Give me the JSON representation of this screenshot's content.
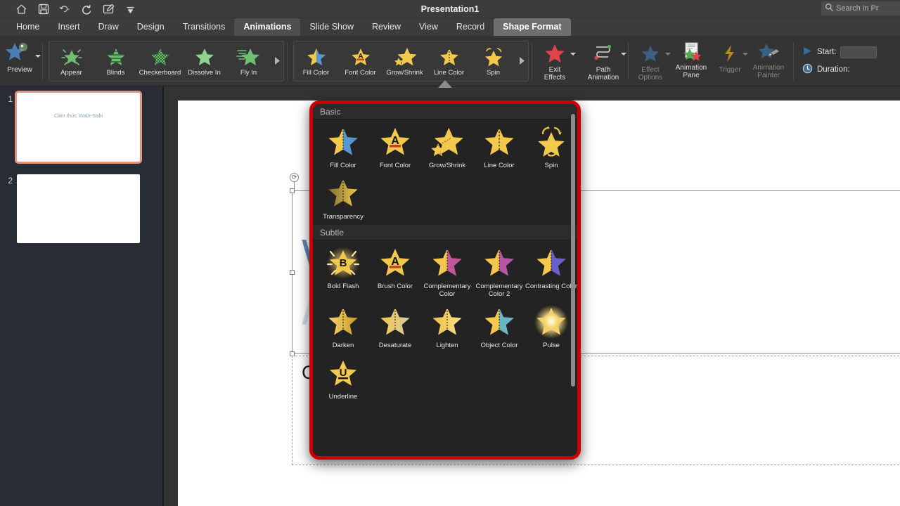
{
  "window": {
    "title": "Presentation1"
  },
  "quick_access": {
    "items": [
      {
        "name": "home-icon",
        "label": "Home"
      },
      {
        "name": "save-icon",
        "label": "Save"
      },
      {
        "name": "undo-icon",
        "label": "Undo"
      },
      {
        "name": "redo-icon",
        "label": "Redo"
      },
      {
        "name": "edit-mode-icon",
        "label": "Start Inking"
      },
      {
        "name": "customize-toolbar-icon",
        "label": "Customize"
      }
    ]
  },
  "search": {
    "placeholder": "Search in Pr",
    "icon": "search-icon"
  },
  "tabs": [
    {
      "label": "Home",
      "state": "normal"
    },
    {
      "label": "Insert",
      "state": "normal"
    },
    {
      "label": "Draw",
      "state": "normal"
    },
    {
      "label": "Design",
      "state": "normal"
    },
    {
      "label": "Transitions",
      "state": "normal"
    },
    {
      "label": "Animations",
      "state": "active"
    },
    {
      "label": "Slide Show",
      "state": "normal"
    },
    {
      "label": "Review",
      "state": "normal"
    },
    {
      "label": "View",
      "state": "normal"
    },
    {
      "label": "Record",
      "state": "normal"
    },
    {
      "label": "Shape Format",
      "state": "contextual"
    }
  ],
  "ribbon": {
    "preview": {
      "label": "Preview",
      "icon": "preview-star-icon"
    },
    "entrance_gallery": [
      {
        "label": "Appear",
        "icon": "star-appear-icon"
      },
      {
        "label": "Blinds",
        "icon": "star-blinds-icon"
      },
      {
        "label": "Checkerboard",
        "icon": "star-checkerboard-icon"
      },
      {
        "label": "Dissolve In",
        "icon": "star-dissolve-icon"
      },
      {
        "label": "Fly In",
        "icon": "star-flyin-icon"
      }
    ],
    "emphasis_gallery": [
      {
        "label": "Fill Color",
        "icon": "star-fill-color-icon"
      },
      {
        "label": "Font Color",
        "icon": "star-font-color-icon"
      },
      {
        "label": "Grow/Shrink",
        "icon": "star-grow-shrink-icon"
      },
      {
        "label": "Line Color",
        "icon": "star-line-color-icon"
      },
      {
        "label": "Spin",
        "icon": "star-spin-icon"
      }
    ],
    "buttons": [
      {
        "label": "Exit\nEffects",
        "line1": "Exit",
        "line2": "Effects",
        "icon": "red-star-icon",
        "enabled": true,
        "has_dropdown": true
      },
      {
        "label": "Path\nAnimation",
        "line1": "Path",
        "line2": "Animation",
        "icon": "motion-path-icon",
        "enabled": true,
        "has_dropdown": true
      },
      {
        "label": "Effect\nOptions",
        "line1": "Effect",
        "line2": "Options",
        "icon": "blue-star-icon",
        "enabled": false,
        "has_dropdown": true
      },
      {
        "label": "Animation\nPane",
        "line1": "Animation",
        "line2": "Pane",
        "icon": "animation-pane-icon",
        "enabled": true,
        "has_dropdown": false
      },
      {
        "label": "Trigger",
        "line1": "Trigger",
        "line2": "",
        "icon": "lightning-icon",
        "enabled": false,
        "has_dropdown": true
      },
      {
        "label": "Animation\nPainter",
        "line1": "Animation",
        "line2": "Painter",
        "icon": "animation-painter-icon",
        "enabled": false,
        "has_dropdown": false
      }
    ],
    "timing": {
      "start_label": "Start:",
      "start_value": "",
      "start_icon": "play-icon",
      "duration_label": "Duration:",
      "duration_value": "",
      "duration_icon": "clock-icon"
    },
    "more_arrow_icon": "chevron-right-icon",
    "expand_arrow_icon": "chevron-down-icon"
  },
  "thumbnails": [
    {
      "number": "1",
      "text": "Cảm thức Wabi-Sabi",
      "selected": true
    },
    {
      "number": "2",
      "text": "",
      "selected": false
    }
  ],
  "slide": {
    "title": "Wabi-Sabi",
    "subtitle_placeholder": "Click to add subtitle",
    "rotate_icon": "rotate-handle-icon"
  },
  "animation_dropdown": {
    "sections": [
      {
        "heading": "Basic",
        "items": [
          {
            "label": "Fill Color",
            "icon": "star-fill-color-icon"
          },
          {
            "label": "Font Color",
            "icon": "star-font-color-icon"
          },
          {
            "label": "Grow/Shrink",
            "icon": "star-grow-shrink-icon"
          },
          {
            "label": "Line Color",
            "icon": "star-line-color-icon"
          },
          {
            "label": "Spin",
            "icon": "star-spin-icon"
          },
          {
            "label": "Transparency",
            "icon": "star-transparency-icon"
          }
        ]
      },
      {
        "heading": "Subtle",
        "items": [
          {
            "label": "Bold Flash",
            "icon": "star-bold-flash-icon"
          },
          {
            "label": "Brush Color",
            "icon": "star-brush-color-icon"
          },
          {
            "label": "Complementary Color",
            "icon": "star-complementary-color-icon"
          },
          {
            "label": "Complementary Color 2",
            "icon": "star-complementary-color-2-icon"
          },
          {
            "label": "Contrasting Color",
            "icon": "star-contrasting-color-icon"
          },
          {
            "label": "Darken",
            "icon": "star-darken-icon"
          },
          {
            "label": "Desaturate",
            "icon": "star-desaturate-icon"
          },
          {
            "label": "Lighten",
            "icon": "star-lighten-icon"
          },
          {
            "label": "Object Color",
            "icon": "star-object-color-icon"
          },
          {
            "label": "Pulse",
            "icon": "star-pulse-icon"
          },
          {
            "label": "Underline",
            "icon": "star-underline-icon"
          }
        ]
      }
    ]
  },
  "colors": {
    "highlight_border": "#cc0000",
    "ribbon_bg": "#343434",
    "titlebar_bg": "#3c3c3c",
    "thumbpane_bg": "#282d35",
    "dropdown_bg": "#232323",
    "star_gold": "#f2c94c",
    "star_green": "#6fbf73",
    "star_blue": "#4a7fb5",
    "star_red": "#e0434a",
    "title_text": "#5b8bbd",
    "selected_thumb_border": "#e8927c"
  }
}
